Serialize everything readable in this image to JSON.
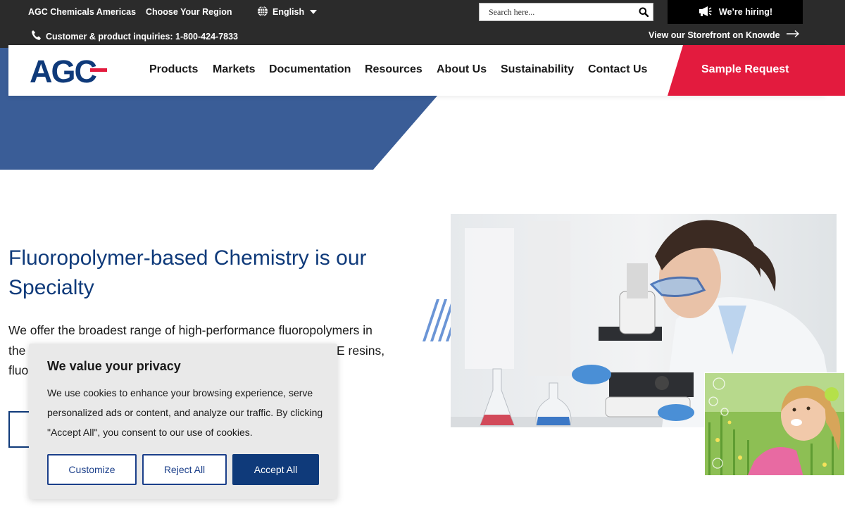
{
  "topbar": {
    "site_name": "AGC Chemicals Americas",
    "region_link": "Choose Your Region",
    "language": "English",
    "search_placeholder": "Search here...",
    "hiring": "We’re hiring!",
    "phone_text": "Customer & product inquiries: 1-800-424-7833",
    "storefront_link": "View our Storefront on Knowde"
  },
  "nav": {
    "logo_text": "AGC",
    "items": [
      "Products",
      "Markets",
      "Documentation",
      "Resources",
      "About Us",
      "Sustainability",
      "Contact Us"
    ],
    "cta": "Sample Request"
  },
  "hero": {
    "headline": "Fluoropolymer-based Chemistry is our Specialty",
    "body_visible_line1": "We offer the broadest range of high-performance fluoropolymers in",
    "body_visible_line2_start": "the",
    "body_visible_line2_end": "E resins,",
    "body_visible_line3_start": "fluo"
  },
  "cookie": {
    "title": "We value your privacy",
    "text": "We use cookies to enhance your browsing experience, serve personalized ads or content, and analyze our traffic. By clicking \"Accept All\", you consent to our use of cookies.",
    "customize": "Customize",
    "reject": "Reject All",
    "accept": "Accept All"
  },
  "colors": {
    "brand_blue": "#0f3a7a",
    "hero_blue": "#3a5d97",
    "accent_red": "#e31b3e",
    "topbar": "#2b2b2b"
  },
  "icons": [
    "globe-icon",
    "caret-down-icon",
    "search-icon",
    "megaphone-icon",
    "phone-icon",
    "arrow-right-icon"
  ]
}
